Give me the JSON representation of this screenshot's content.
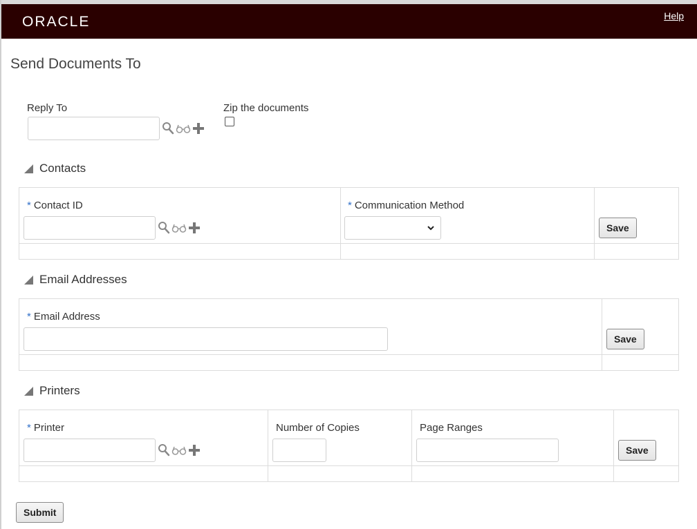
{
  "header": {
    "logo_text": "ORACLE",
    "help_label": "Help"
  },
  "page": {
    "title": "Send Documents To"
  },
  "reply_to": {
    "label": "Reply To",
    "value": ""
  },
  "zip": {
    "label": "Zip the documents",
    "checked": false
  },
  "contacts": {
    "section_title": "Contacts",
    "contact_id_label": "Contact ID",
    "communication_method_label": "Communication Method",
    "communication_method_value": "",
    "save_label": "Save"
  },
  "emails": {
    "section_title": "Email Addresses",
    "email_label": "Email Address",
    "save_label": "Save"
  },
  "printers": {
    "section_title": "Printers",
    "printer_label": "Printer",
    "copies_label": "Number of Copies",
    "ranges_label": "Page Ranges",
    "save_label": "Save"
  },
  "required_marker": "*",
  "submit_label": "Submit",
  "colors": {
    "header_bg": "#2a0000",
    "required": "#3371c9"
  },
  "icons": [
    "search-icon",
    "glasses-icon",
    "plus-icon",
    "triangle-icon",
    "chevron-down-icon"
  ]
}
